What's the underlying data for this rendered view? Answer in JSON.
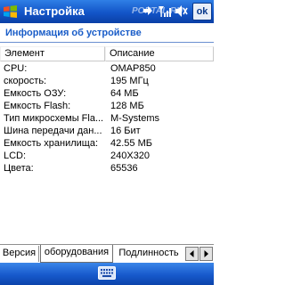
{
  "titlebar": {
    "title": "Настройка",
    "watermark": "PORTAL.RU",
    "ok_label": "ok"
  },
  "page": {
    "title": "Информация об устройстве"
  },
  "table": {
    "headers": [
      "Элемент",
      "Описание"
    ],
    "rows": [
      [
        "CPU:",
        "OMAP850"
      ],
      [
        "скорость:",
        "195 МГц"
      ],
      [
        "Емкость ОЗУ:",
        "64 МБ"
      ],
      [
        "Емкость Flash:",
        "128 МБ"
      ],
      [
        "Тип микросхемы Fla...",
        "M-Systems"
      ],
      [
        "Шина передачи дан...",
        "16 Бит"
      ],
      [
        "Емкость хранилища:",
        "42.55 МБ"
      ],
      [
        "LCD:",
        "240X320"
      ],
      [
        "Цвета:",
        "65536"
      ]
    ]
  },
  "tabs": [
    {
      "label": "Версия"
    },
    {
      "label": "оборудования",
      "selected": true
    },
    {
      "label": "Подлинность"
    }
  ],
  "icons": {
    "start": "windows-start-icon",
    "connectivity": "connectivity-icon",
    "signal": "signal-icon",
    "volume": "volume-icon",
    "keyboard": "keyboard-icon"
  },
  "colors": {
    "titlebar": "#1355c8",
    "page_title": "#1a5dc8"
  }
}
